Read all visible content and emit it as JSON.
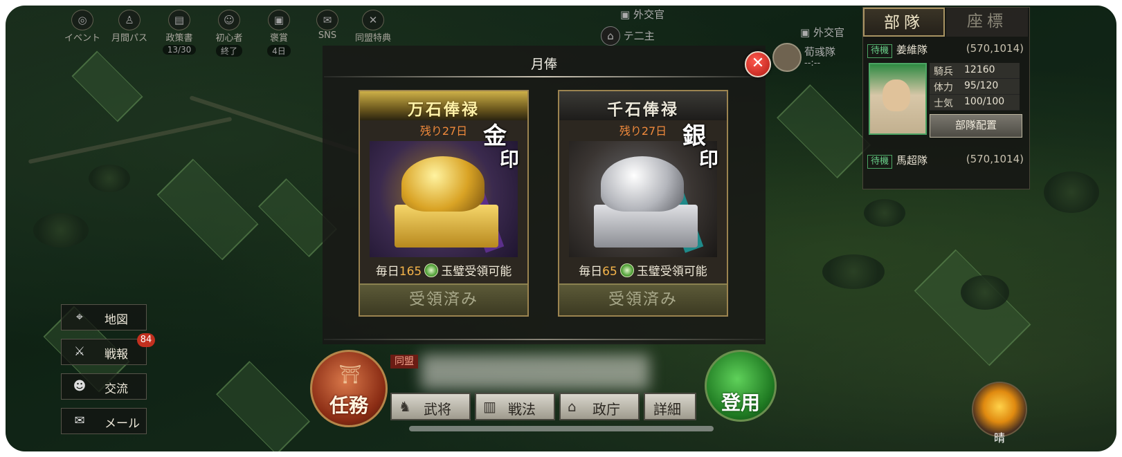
{
  "top_icons": [
    {
      "label": "イベント",
      "icon": "event-icon",
      "sub": ""
    },
    {
      "label": "月間パス",
      "icon": "monthly-pass-icon",
      "sub": ""
    },
    {
      "label": "政策書",
      "icon": "policy-book-icon",
      "sub": "13/30"
    },
    {
      "label": "初心者",
      "icon": "beginner-icon",
      "sub": "終了"
    },
    {
      "label": "褒賞",
      "icon": "reward-icon",
      "sub": "4日"
    },
    {
      "label": "SNS",
      "icon": "sns-icon",
      "sub": ""
    },
    {
      "label": "同盟特典",
      "icon": "alliance-perk-icon",
      "sub": ""
    }
  ],
  "map": {
    "official_label_1": "外交官",
    "player_label": "テ二主",
    "official_label_2": "外交官",
    "enemy_unit": "荀彧隊",
    "enemy_timer": "--:--"
  },
  "modal": {
    "title": "月俸",
    "close_icon": "close-icon",
    "cards": [
      {
        "variant": "gold",
        "name": "万石俸禄",
        "remaining": "残り27日",
        "stamp_1": "金",
        "stamp_2": "印",
        "daily_prefix": "毎日",
        "daily_amount": "165",
        "daily_suffix": "玉璧受領可能",
        "claim_label": "受領済み"
      },
      {
        "variant": "silver",
        "name": "千石俸禄",
        "remaining": "残り27日",
        "stamp_1": "銀",
        "stamp_2": "印",
        "daily_prefix": "毎日",
        "daily_amount": "65",
        "daily_suffix": "玉璧受領可能",
        "claim_label": "受領済み"
      }
    ]
  },
  "right_panel": {
    "tab_units": "部隊",
    "tab_coords": "座標",
    "unit_1": {
      "status": "待機",
      "name": "姜維隊",
      "coord": "(570,1014)"
    },
    "stats": [
      {
        "key": "騎兵",
        "value": "12160"
      },
      {
        "key": "体力",
        "value": "95/120"
      },
      {
        "key": "士気",
        "value": "100/100"
      }
    ],
    "deploy_label": "部隊配置",
    "unit_2": {
      "status": "待機",
      "name": "馬超隊",
      "coord": "(570,1014)"
    }
  },
  "side_buttons": [
    {
      "label": "地図",
      "icon": "map-pin-icon"
    },
    {
      "label": "戦報",
      "icon": "crossed-swords-icon"
    },
    {
      "label": "交流",
      "icon": "people-icon"
    },
    {
      "label": "メール",
      "icon": "mail-icon"
    }
  ],
  "battle_badge": "84",
  "bottom": {
    "mission_label": "任務",
    "alliance_tag": "同盟",
    "buttons": [
      {
        "label": "武将",
        "icon": "general-icon"
      },
      {
        "label": "戦法",
        "icon": "tactics-icon"
      },
      {
        "label": "政庁",
        "icon": "government-icon"
      },
      {
        "label": "詳細",
        "icon": ""
      }
    ],
    "recruit_label": "登用",
    "weather_label": "晴"
  }
}
